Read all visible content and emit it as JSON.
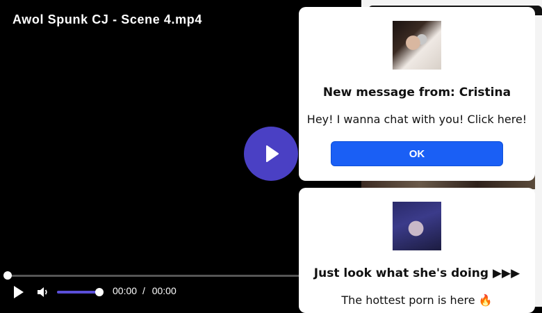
{
  "player": {
    "title": "Awol Spunk CJ - Scene 4.mp4",
    "current_time": "00:00",
    "separator": "/",
    "duration": "00:00",
    "volume_level": 1.0,
    "progress": 0,
    "accent_color": "#4a40c4"
  },
  "popups": [
    {
      "heading": "New message from: Cristina",
      "body": "Hey! I wanna chat with you! Click here!",
      "button_label": "OK"
    },
    {
      "heading": "Just look what she's doing ▶▶▶",
      "body": "The hottest porn is here 🔥"
    }
  ],
  "colors": {
    "button_blue": "#1a5ff5",
    "background": "#000000"
  }
}
